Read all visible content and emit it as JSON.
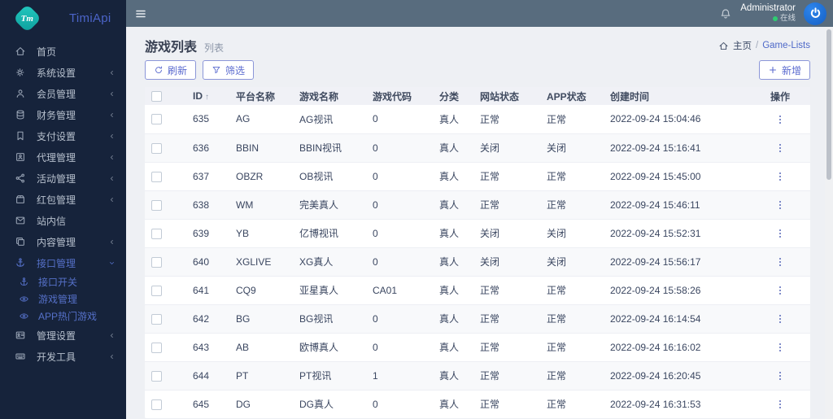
{
  "colors": {
    "accent": "#5a6acf",
    "sidebar_bg": "#16233b",
    "topbar_bg": "#586c7e",
    "content_bg": "#eef0f4",
    "active_link": "#5570c8",
    "status_online_green": "#2ecc71",
    "avatar_blue": "#1a6fd4",
    "logo_teal": "#14b4ae"
  },
  "app": {
    "name": "TimiApi",
    "monogram": "Tm"
  },
  "topbar": {
    "menu_icon": "menu",
    "bell_icon": "bell",
    "user": {
      "name": "Administrator",
      "status": "在线"
    },
    "avatar_icon": "power"
  },
  "sidebar": {
    "items": [
      {
        "icon": "home",
        "label": "首页",
        "chevron": null,
        "active": false
      },
      {
        "icon": "gears",
        "label": "系统设置",
        "chevron": "left",
        "active": false
      },
      {
        "icon": "user",
        "label": "会员管理",
        "chevron": "left",
        "active": false
      },
      {
        "icon": "database",
        "label": "财务管理",
        "chevron": "left",
        "active": false
      },
      {
        "icon": "bookmark",
        "label": "支付设置",
        "chevron": "left",
        "active": false
      },
      {
        "icon": "id-card",
        "label": "代理管理",
        "chevron": "left",
        "active": false
      },
      {
        "icon": "share",
        "label": "活动管理",
        "chevron": "left",
        "active": false
      },
      {
        "icon": "box",
        "label": "红包管理",
        "chevron": "left",
        "active": false
      },
      {
        "icon": "mail",
        "label": "站内信",
        "chevron": null,
        "active": false
      },
      {
        "icon": "copy",
        "label": "内容管理",
        "chevron": "left",
        "active": false
      },
      {
        "icon": "anchor",
        "label": "接口管理",
        "chevron": "down",
        "active": true,
        "children": [
          {
            "icon": "anchor",
            "label": "接口开关",
            "active": true
          },
          {
            "icon": "eye",
            "label": "游戏管理",
            "active": true
          },
          {
            "icon": "eye",
            "label": "APP热门游戏",
            "active": true
          }
        ]
      },
      {
        "icon": "contact-card",
        "label": "管理设置",
        "chevron": "left",
        "active": false
      },
      {
        "icon": "keyboard",
        "label": "开发工具",
        "chevron": "left",
        "active": false
      }
    ]
  },
  "page": {
    "title": "游戏列表",
    "subtitle": "列表"
  },
  "breadcrumb": {
    "home_icon": "home",
    "home": "主页",
    "separator": "/",
    "current": "Game-Lists"
  },
  "toolbar": {
    "refresh": {
      "label": "刷新",
      "icon": "refresh"
    },
    "filter": {
      "label": "筛选",
      "icon": "funnel"
    },
    "add": {
      "label": "新增",
      "icon": "plus"
    }
  },
  "table": {
    "columns": [
      "ID",
      "平台名称",
      "游戏名称",
      "游戏代码",
      "分类",
      "网站状态",
      "APP状态",
      "创建时间",
      "操作"
    ],
    "sort": {
      "column": "ID",
      "direction": "asc",
      "indicator": "↑"
    },
    "row_action_icon": "kebab",
    "rows": [
      {
        "id": "635",
        "platform": "AG",
        "game_name": "AG视讯",
        "game_code": "0",
        "category": "真人",
        "site_status": "正常",
        "app_status": "正常",
        "created_at": "2022-09-24 15:04:46"
      },
      {
        "id": "636",
        "platform": "BBIN",
        "game_name": "BBIN视讯",
        "game_code": "0",
        "category": "真人",
        "site_status": "关闭",
        "app_status": "关闭",
        "created_at": "2022-09-24 15:16:41"
      },
      {
        "id": "637",
        "platform": "OBZR",
        "game_name": "OB视讯",
        "game_code": "0",
        "category": "真人",
        "site_status": "正常",
        "app_status": "正常",
        "created_at": "2022-09-24 15:45:00"
      },
      {
        "id": "638",
        "platform": "WM",
        "game_name": "完美真人",
        "game_code": "0",
        "category": "真人",
        "site_status": "正常",
        "app_status": "正常",
        "created_at": "2022-09-24 15:46:11"
      },
      {
        "id": "639",
        "platform": "YB",
        "game_name": "亿博视讯",
        "game_code": "0",
        "category": "真人",
        "site_status": "关闭",
        "app_status": "关闭",
        "created_at": "2022-09-24 15:52:31"
      },
      {
        "id": "640",
        "platform": "XGLIVE",
        "game_name": "XG真人",
        "game_code": "0",
        "category": "真人",
        "site_status": "关闭",
        "app_status": "关闭",
        "created_at": "2022-09-24 15:56:17"
      },
      {
        "id": "641",
        "platform": "CQ9",
        "game_name": "亚星真人",
        "game_code": "CA01",
        "category": "真人",
        "site_status": "正常",
        "app_status": "正常",
        "created_at": "2022-09-24 15:58:26"
      },
      {
        "id": "642",
        "platform": "BG",
        "game_name": "BG视讯",
        "game_code": "0",
        "category": "真人",
        "site_status": "正常",
        "app_status": "正常",
        "created_at": "2022-09-24 16:14:54"
      },
      {
        "id": "643",
        "platform": "AB",
        "game_name": "欧博真人",
        "game_code": "0",
        "category": "真人",
        "site_status": "正常",
        "app_status": "正常",
        "created_at": "2022-09-24 16:16:02"
      },
      {
        "id": "644",
        "platform": "PT",
        "game_name": "PT视讯",
        "game_code": "1",
        "category": "真人",
        "site_status": "正常",
        "app_status": "正常",
        "created_at": "2022-09-24 16:20:45"
      },
      {
        "id": "645",
        "platform": "DG",
        "game_name": "DG真人",
        "game_code": "0",
        "category": "真人",
        "site_status": "正常",
        "app_status": "正常",
        "created_at": "2022-09-24 16:31:53"
      }
    ]
  }
}
